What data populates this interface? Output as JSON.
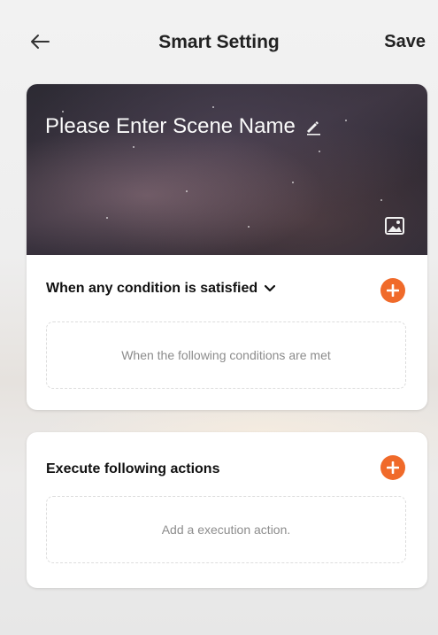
{
  "header": {
    "back_icon": "back-arrow-icon",
    "title": "Smart Setting",
    "save_label": "Save"
  },
  "scene": {
    "name_placeholder": "Please Enter Scene Name",
    "edit_icon": "pencil-icon",
    "image_icon": "image-icon"
  },
  "condition": {
    "heading": "When any condition is satisfied",
    "dropdown_icon": "chevron-down-icon",
    "add_icon": "plus-circle-icon",
    "placeholder": "When the following conditions are met"
  },
  "actions": {
    "heading": "Execute following actions",
    "add_icon": "plus-circle-icon",
    "placeholder": "Add a execution action."
  },
  "colors": {
    "accent": "#f06a2a",
    "banner": "#2c2a33",
    "text": "#222222",
    "muted": "#8c8c8c"
  }
}
